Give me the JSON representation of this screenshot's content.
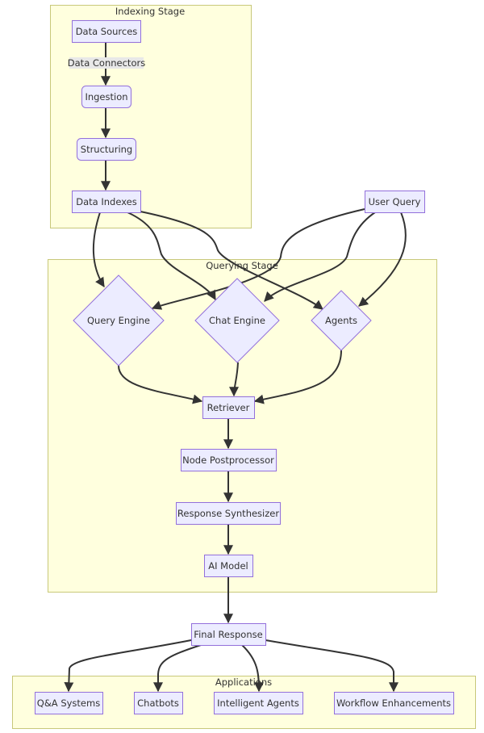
{
  "colors": {
    "cluster_fill": "#ffffde",
    "cluster_border": "#c8c87a",
    "node_fill": "#ececff",
    "node_border": "#9370db",
    "edge": "#333333"
  },
  "clusters": {
    "indexing": "Indexing Stage",
    "querying": "Querying Stage",
    "applications": "Applications"
  },
  "nodes": {
    "data_sources": "Data Sources",
    "ingestion": "Ingestion",
    "structuring": "Structuring",
    "data_indexes": "Data Indexes",
    "user_query": "User Query",
    "query_engine": "Query Engine",
    "chat_engine": "Chat Engine",
    "agents": "Agents",
    "retriever": "Retriever",
    "node_postprocessor": "Node Postprocessor",
    "response_synthesizer": "Response Synthesizer",
    "ai_model": "AI Model",
    "final_response": "Final Response",
    "qa_systems": "Q&A Systems",
    "chatbots": "Chatbots",
    "intelligent_agents": "Intelligent Agents",
    "workflow_enhancements": "Workflow Enhancements"
  },
  "edge_labels": {
    "data_connectors": "Data Connectors"
  }
}
